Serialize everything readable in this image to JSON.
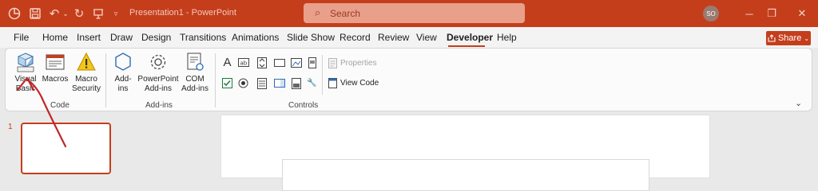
{
  "titlebar": {
    "title": "Presentation1  -  PowerPoint",
    "search_placeholder": "Search",
    "avatar_initials": "SO",
    "brand_color": "#c43e1c"
  },
  "menu": {
    "tabs": [
      "File",
      "Home",
      "Insert",
      "Draw",
      "Design",
      "Transitions",
      "Animations",
      "Slide Show",
      "Record",
      "Review",
      "View",
      "Developer",
      "Help"
    ],
    "active_tab": "Developer",
    "share_label": "Share"
  },
  "ribbon": {
    "code": {
      "label": "Code",
      "visual_basic": "Visual Basic",
      "macros": "Macros",
      "macro_security": "Macro Security"
    },
    "addins": {
      "label": "Add-ins",
      "addins": "Add-ins",
      "powerpoint_addins": "PowerPoint Add-ins",
      "com_addins": "COM Add-ins"
    },
    "controls": {
      "label": "Controls",
      "properties": "Properties",
      "view_code": "View Code"
    }
  },
  "slides": {
    "current_number": "1"
  }
}
